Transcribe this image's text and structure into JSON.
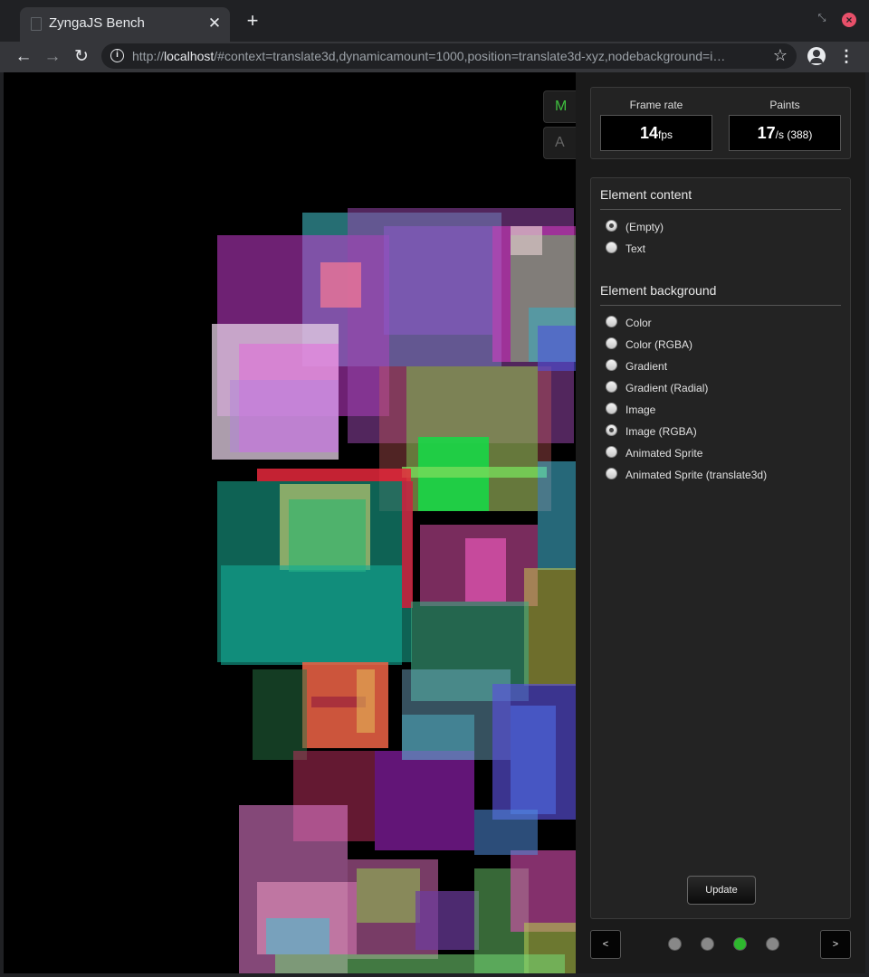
{
  "browser": {
    "tab_title": "ZyngaJS Bench",
    "tab_close": "✕",
    "new_tab": "+",
    "url_prefix": "http://",
    "url_host": "localhost",
    "url_rest": "/#context=translate3d,dynamicamount=1000,position=translate3d-xyz,nodebackground=i…",
    "icons": {
      "back": "arrow-left-icon",
      "forward": "arrow-right-icon",
      "reload": "reload-icon",
      "info": "info-icon",
      "bookmark": "star-icon",
      "account": "account-icon",
      "menu": "kebab-menu-icon"
    }
  },
  "side_tabs": {
    "m": "M",
    "a": "A"
  },
  "stats": {
    "frame_rate_label": "Frame rate",
    "frame_rate_value": "14",
    "frame_rate_unit": "fps",
    "paints_label": "Paints",
    "paints_value": "17",
    "paints_unit": "/s (388)"
  },
  "element_content": {
    "title": "Element content",
    "options": [
      {
        "label": "(Empty)",
        "checked": true
      },
      {
        "label": "Text",
        "checked": false
      }
    ]
  },
  "element_background": {
    "title": "Element background",
    "options": [
      {
        "label": "Color",
        "checked": false
      },
      {
        "label": "Color (RGBA)",
        "checked": false
      },
      {
        "label": "Gradient",
        "checked": false
      },
      {
        "label": "Gradient (Radial)",
        "checked": false
      },
      {
        "label": "Image",
        "checked": false
      },
      {
        "label": "Image (RGBA)",
        "checked": true
      },
      {
        "label": "Animated Sprite",
        "checked": false
      },
      {
        "label": "Animated Sprite (translate3d)",
        "checked": false
      }
    ]
  },
  "update_button": "Update",
  "pager": {
    "prev": "<",
    "next": ">",
    "dots": [
      false,
      false,
      true,
      false
    ]
  },
  "colors": {
    "accent_green": "#2eb82e",
    "stage_background": "#000000"
  }
}
